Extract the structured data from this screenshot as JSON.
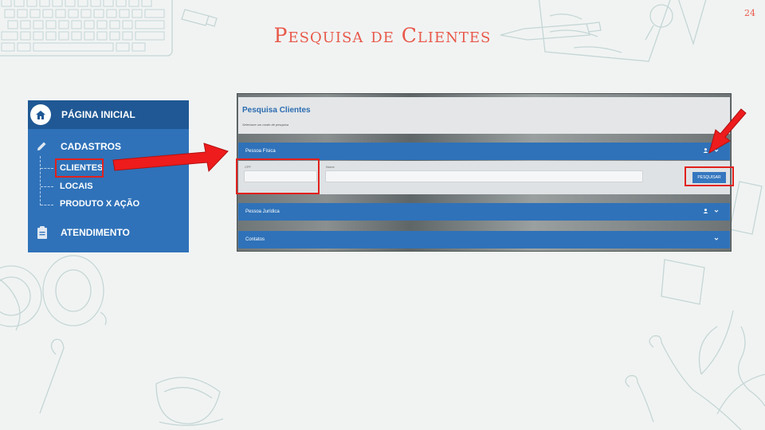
{
  "slide": {
    "title": "Pesquisa de Clientes",
    "number": "24"
  },
  "menu": {
    "home_label": "PÁGINA INICIAL",
    "cadastros_label": "CADASTROS",
    "sub_items": [
      "CLIENTES",
      "LOCAIS",
      "PRODUTO X AÇÃO"
    ],
    "atendimento_label": "ATENDIMENTO"
  },
  "search_panel": {
    "title": "Pesquisa Clientes",
    "subtitle": "Selecione um modo de pesquisa",
    "sections": {
      "pessoa_fisica": "Pessoa Física",
      "pessoa_juridica": "Pessoa Jurídica",
      "contatos": "Contatos"
    },
    "fields": {
      "cpf_label": "CPF",
      "cpf_value": "",
      "nome_label": "Nome",
      "nome_value": ""
    },
    "search_button": "PESQUISAR"
  },
  "colors": {
    "accent_red": "#e2201c",
    "title_coral": "#e8594a",
    "menu_blue": "#2f72b9",
    "menu_dark_blue": "#1f5894"
  },
  "icons": [
    "home-icon",
    "pencil-icon",
    "clipboard-icon",
    "user-icon",
    "chevron-down-icon",
    "arrow-right-icon",
    "arrow-down-left-icon"
  ]
}
